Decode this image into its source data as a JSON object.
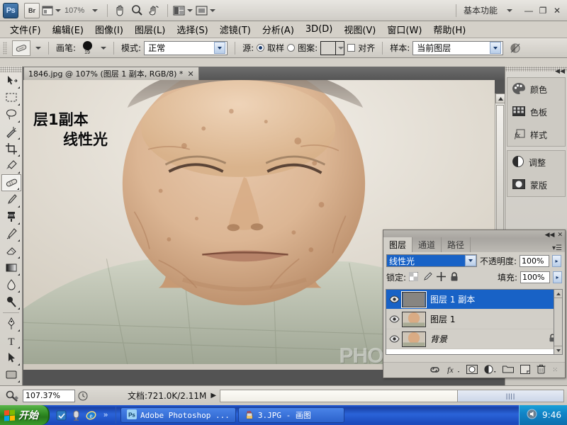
{
  "app": {
    "title": "Adobe Photoshop",
    "workspace": "基本功能",
    "zoom_appbar": "107%",
    "ps_logo": "Ps",
    "bridge_logo": "Br",
    "minimize": "—",
    "maximize": "❐",
    "close": "✕"
  },
  "menubar": {
    "items": [
      {
        "label": "文件(F)"
      },
      {
        "label": "编辑(E)"
      },
      {
        "label": "图像(I)"
      },
      {
        "label": "图层(L)"
      },
      {
        "label": "选择(S)"
      },
      {
        "label": "滤镜(T)"
      },
      {
        "label": "分析(A)"
      },
      {
        "label": "3D(D)"
      },
      {
        "label": "视图(V)"
      },
      {
        "label": "窗口(W)"
      },
      {
        "label": "帮助(H)"
      }
    ]
  },
  "options_bar": {
    "brush_label": "画笔:",
    "brush_size": "19",
    "mode_label": "模式:",
    "mode_value": "正常",
    "source_label": "源:",
    "source_sampled": "取样",
    "source_pattern": "图案:",
    "aligned_label": "对齐",
    "sample_label": "样本:",
    "sample_value": "当前图层"
  },
  "toolbox": {
    "tools": [
      {
        "name": "move-tool",
        "active": false
      },
      {
        "name": "marquee-tool",
        "active": false
      },
      {
        "name": "lasso-tool",
        "active": false
      },
      {
        "name": "magic-wand-tool",
        "active": false
      },
      {
        "name": "crop-tool",
        "active": false
      },
      {
        "name": "eyedropper-tool",
        "active": false
      },
      {
        "name": "healing-brush-tool",
        "active": true
      },
      {
        "name": "brush-tool",
        "active": false
      },
      {
        "name": "clone-stamp-tool",
        "active": false
      },
      {
        "name": "history-brush-tool",
        "active": false
      },
      {
        "name": "eraser-tool",
        "active": false
      },
      {
        "name": "gradient-tool",
        "active": false
      },
      {
        "name": "blur-tool",
        "active": false
      },
      {
        "name": "dodge-tool",
        "active": false
      },
      {
        "name": "pen-tool",
        "active": false
      },
      {
        "name": "type-tool",
        "active": false
      },
      {
        "name": "path-selection-tool",
        "active": false
      },
      {
        "name": "shape-tool",
        "active": false
      }
    ]
  },
  "document": {
    "tab_title": "1846.jpg @ 107% (图层 1 副本, RGB/8) *",
    "close_glyph": "✕",
    "annotation_1": "层1副本",
    "annotation_2": "线性光",
    "watermark": "PHOTOPS.COM"
  },
  "right_dock": {
    "group_a": [
      {
        "label": "颜色",
        "icon": "color-palette-icon"
      },
      {
        "label": "色板",
        "icon": "swatches-grid-icon"
      },
      {
        "label": "样式",
        "icon": "styles-fx-icon"
      }
    ],
    "group_b": [
      {
        "label": "调整",
        "icon": "adjustments-circle-icon"
      },
      {
        "label": "蒙版",
        "icon": "masks-icon"
      }
    ]
  },
  "layers_panel": {
    "tabs": [
      {
        "label": "图层",
        "active": true
      },
      {
        "label": "通道",
        "active": false
      },
      {
        "label": "路径",
        "active": false
      }
    ],
    "blend_mode": "线性光",
    "opacity_label": "不透明度:",
    "opacity_value": "100%",
    "lock_label": "锁定:",
    "fill_label": "填充:",
    "fill_value": "100%",
    "layers": [
      {
        "name": "图层 1 副本",
        "selected": true,
        "locked": false,
        "italic": false,
        "thumb": "gray"
      },
      {
        "name": "图层 1",
        "selected": false,
        "locked": false,
        "italic": false,
        "thumb": "photo"
      },
      {
        "name": "背景",
        "selected": false,
        "locked": true,
        "italic": true,
        "thumb": "photo"
      }
    ],
    "lock_glyph": "🔒",
    "footer_icons": [
      {
        "name": "link-layers-icon",
        "glyph": "⛓"
      },
      {
        "name": "layer-style-fx-icon",
        "glyph": "fx"
      },
      {
        "name": "layer-mask-icon",
        "glyph": "◉"
      },
      {
        "name": "new-adjustment-layer-icon",
        "glyph": "◑"
      },
      {
        "name": "new-group-icon",
        "glyph": "▭"
      },
      {
        "name": "new-layer-icon",
        "glyph": "◲"
      },
      {
        "name": "delete-layer-icon",
        "glyph": "🗑"
      }
    ]
  },
  "status_bar": {
    "zoom": "107.37%",
    "doc_info": "文档:721.0K/2.11M",
    "arrow_glyph": "▶"
  },
  "taskbar": {
    "start_label": "开始",
    "quick_launch": [
      {
        "name": "show-desktop-icon"
      },
      {
        "name": "media-player-icon"
      },
      {
        "name": "internet-explorer-icon"
      },
      {
        "name": "more-chevrons-icon"
      }
    ],
    "tasks": [
      {
        "label": "Adobe Photoshop ...",
        "icon": "photoshop-icon",
        "active": true
      },
      {
        "label": "3.JPG - 画图",
        "icon": "paint-icon",
        "active": false
      }
    ],
    "clock": "9:46",
    "tray_icon": "volume-icon"
  },
  "colors": {
    "panel_bg": "#d2cfc8",
    "chrome_bg": "#d4d0c8",
    "selection_blue": "#1862c6",
    "canvas_gray": "#535353",
    "taskbar_blue": "#245edb",
    "start_green": "#2f8b22"
  }
}
